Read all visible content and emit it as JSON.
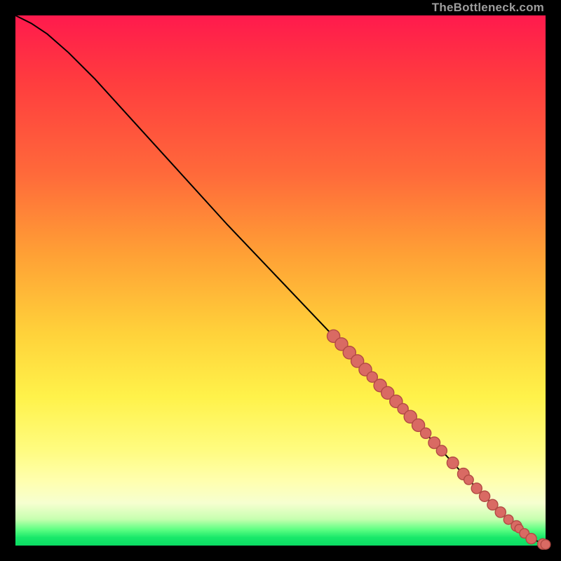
{
  "watermark": "TheBottleneck.com",
  "colors": {
    "point_fill": "#d96a63",
    "point_stroke": "#b24a44",
    "curve": "#000000"
  },
  "chart_data": {
    "type": "line",
    "title": "",
    "xlabel": "",
    "ylabel": "",
    "xlim": [
      0,
      100
    ],
    "ylim": [
      0,
      100
    ],
    "grid": false,
    "series": [
      {
        "name": "bottleneck-curve",
        "x": [
          0,
          3,
          6,
          10,
          15,
          20,
          30,
          40,
          50,
          60,
          70,
          78,
          84,
          88,
          92,
          95,
          97,
          98.5,
          99.5,
          100
        ],
        "y": [
          100,
          98.5,
          96.5,
          93,
          88,
          82.5,
          71.5,
          60.5,
          50,
          39.5,
          29,
          20.5,
          14,
          9.8,
          5.8,
          3.2,
          1.6,
          0.8,
          0.3,
          0.2
        ]
      }
    ],
    "points": [
      {
        "x": 60.0,
        "y": 39.5,
        "r": 1.2
      },
      {
        "x": 61.5,
        "y": 38.0,
        "r": 1.2
      },
      {
        "x": 63.0,
        "y": 36.4,
        "r": 1.2
      },
      {
        "x": 64.5,
        "y": 34.8,
        "r": 1.2
      },
      {
        "x": 66.0,
        "y": 33.2,
        "r": 1.2
      },
      {
        "x": 67.3,
        "y": 31.8,
        "r": 1.0
      },
      {
        "x": 68.8,
        "y": 30.2,
        "r": 1.2
      },
      {
        "x": 70.2,
        "y": 28.8,
        "r": 1.2
      },
      {
        "x": 71.8,
        "y": 27.2,
        "r": 1.2
      },
      {
        "x": 73.1,
        "y": 25.8,
        "r": 1.0
      },
      {
        "x": 74.5,
        "y": 24.3,
        "r": 1.2
      },
      {
        "x": 76.0,
        "y": 22.7,
        "r": 1.2
      },
      {
        "x": 77.4,
        "y": 21.2,
        "r": 1.0
      },
      {
        "x": 79.0,
        "y": 19.4,
        "r": 1.1
      },
      {
        "x": 80.4,
        "y": 17.9,
        "r": 1.0
      },
      {
        "x": 82.5,
        "y": 15.6,
        "r": 1.1
      },
      {
        "x": 84.5,
        "y": 13.5,
        "r": 1.1
      },
      {
        "x": 85.5,
        "y": 12.4,
        "r": 0.9
      },
      {
        "x": 87.0,
        "y": 10.8,
        "r": 1.0
      },
      {
        "x": 88.5,
        "y": 9.3,
        "r": 1.0
      },
      {
        "x": 90.0,
        "y": 7.7,
        "r": 1.0
      },
      {
        "x": 91.5,
        "y": 6.3,
        "r": 1.0
      },
      {
        "x": 93.0,
        "y": 4.9,
        "r": 0.9
      },
      {
        "x": 94.5,
        "y": 3.7,
        "r": 1.0
      },
      {
        "x": 95.0,
        "y": 3.2,
        "r": 0.8
      },
      {
        "x": 96.0,
        "y": 2.3,
        "r": 0.9
      },
      {
        "x": 97.3,
        "y": 1.3,
        "r": 1.0
      },
      {
        "x": 99.5,
        "y": 0.3,
        "r": 1.0
      },
      {
        "x": 100.0,
        "y": 0.2,
        "r": 0.9
      }
    ]
  }
}
